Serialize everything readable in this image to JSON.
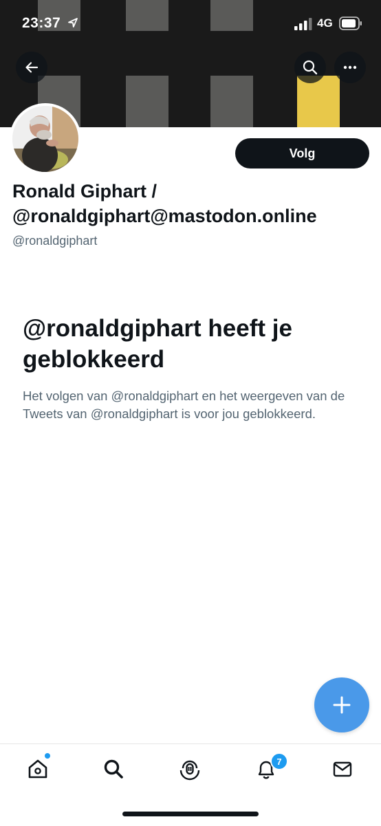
{
  "status_bar": {
    "time": "23:37",
    "network": "4G",
    "icons": [
      "location-arrow-icon",
      "signal-bars-icon",
      "battery-icon"
    ]
  },
  "banner": {
    "colors": {
      "background": "#1a1a1a",
      "window": "#5a5a58",
      "lit_window": "#e8c84a"
    }
  },
  "header_actions": {
    "back_icon": "arrow-left-icon",
    "search_icon": "search-icon",
    "more_icon": "more-horizontal-icon"
  },
  "profile": {
    "display_name": "Ronald Giphart / @ronaldgiphart@mastodon.online",
    "handle": "@ronaldgiphart",
    "follow_label": "Volg"
  },
  "blocked": {
    "title": "@ronaldgiphart heeft je geblokkeerd",
    "description": "Het volgen van @ronaldgiphart en het weergeven van de Tweets van @ronaldgiphart is voor jou geblokkeerd."
  },
  "fab": {
    "icon": "plus-icon",
    "color": "#4a99e9"
  },
  "tab_bar": {
    "items": [
      {
        "name": "home",
        "icon": "home-icon",
        "has_dot": true
      },
      {
        "name": "search",
        "icon": "search-icon"
      },
      {
        "name": "spaces",
        "icon": "spaces-icon"
      },
      {
        "name": "notifications",
        "icon": "bell-icon",
        "badge": "7"
      },
      {
        "name": "messages",
        "icon": "mail-icon"
      }
    ],
    "accent": "#1d9bf0"
  }
}
